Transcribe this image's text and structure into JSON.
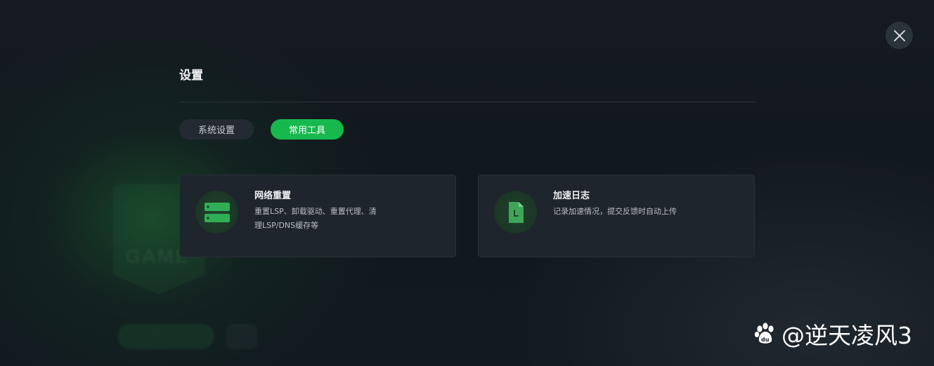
{
  "dialog": {
    "title": "设置",
    "close_icon": "close-icon"
  },
  "tabs": [
    {
      "label": "系统设置",
      "active": false
    },
    {
      "label": "常用工具",
      "active": true
    }
  ],
  "tools": [
    {
      "title": "网络重置",
      "description": "重置LSP、卸载驱动、重置代理、清理LSP/DNS缓存等",
      "icon": "server-icon"
    },
    {
      "title": "加速日志",
      "description": "记录加速情况，提交反馈时自动上传",
      "icon": "log-file-icon"
    }
  ],
  "watermark": {
    "text": "@逆天凌风3",
    "icon": "baidu-paw-icon"
  },
  "colors": {
    "accent": "#17b94f",
    "background": "#141a20",
    "card": "#1e252c"
  }
}
